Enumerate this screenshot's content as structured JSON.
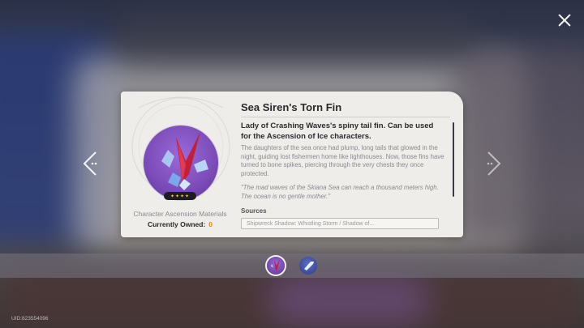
{
  "item": {
    "name": "Sea Siren's Torn Fin",
    "rarity_stars": "✦✦✦✦",
    "category": "Character Ascension Materials",
    "owned_label": "Currently Owned:",
    "owned_count": "0",
    "description": "Lady of Crashing Waves's spiny tail fin. Can be used for the Ascension of Ice characters.",
    "lore": "The daughters of the sea once had plump, long tails that glowed in the night, guiding lost fishermen home like lighthouses. Now, those fins have turned to bone spikes, piercing through the very chests they once protected.",
    "quote": "\"The mad waves of the Skiana Sea can reach a thousand meters high. The ocean is no gentle mother.\"",
    "sources_label": "Sources",
    "sources_value": "Shipwreck Shadow: Whistling Storm / Shadow of..."
  },
  "footer": {
    "uid": "UID:823554096"
  },
  "icons": {
    "close": "close-icon",
    "prev": "chevron-left-icon",
    "next": "chevron-right-icon"
  },
  "colors": {
    "owned_count": "#e08a1c",
    "item_bg": "#7b4bb8",
    "card_bg": "#efede9"
  }
}
